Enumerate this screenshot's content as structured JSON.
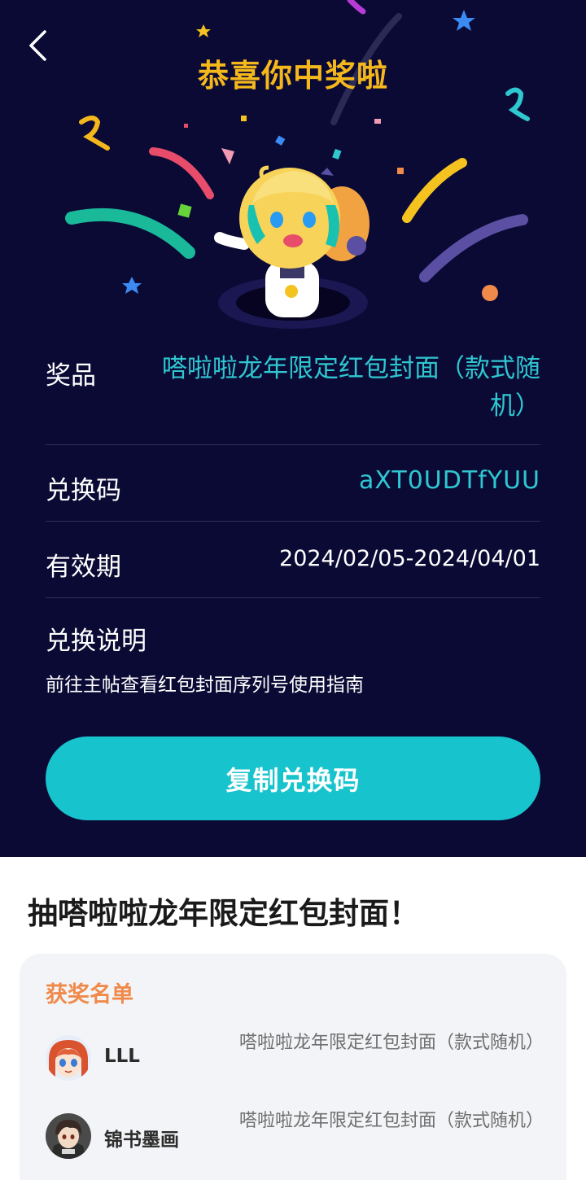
{
  "header": {
    "back_icon": "chevron-left-icon",
    "title": "恭喜你中奖啦"
  },
  "prize_info": {
    "prize_label": "奖品",
    "prize_value": "嗒啦啦龙年限定红包封面（款式随机）",
    "code_label": "兑换码",
    "code_value": "aXT0UDTfYUU",
    "validity_label": "有效期",
    "validity_value": "2024/02/05-2024/04/01",
    "instructions_label": "兑换说明",
    "instructions_text": "前往主帖查看红包封面序列号使用指南"
  },
  "copy_button": {
    "label": "复制兑换码"
  },
  "event": {
    "title": "抽嗒啦啦龙年限定红包封面！"
  },
  "winners": {
    "heading": "获奖名单",
    "list": [
      {
        "name": "LLL",
        "prize": "嗒啦啦龙年限定红包封面（款式随机）",
        "avatar": "anime-girl-avatar"
      },
      {
        "name": "锦书墨画",
        "prize": "嗒啦啦龙年限定红包封面（款式随机）",
        "avatar": "anime-boy-avatar"
      }
    ]
  },
  "colors": {
    "hero_background": "#0b0a35",
    "title_gold": "#f5b81c",
    "accent_teal": "#17c3cc",
    "winners_heading": "#f08a4b"
  }
}
